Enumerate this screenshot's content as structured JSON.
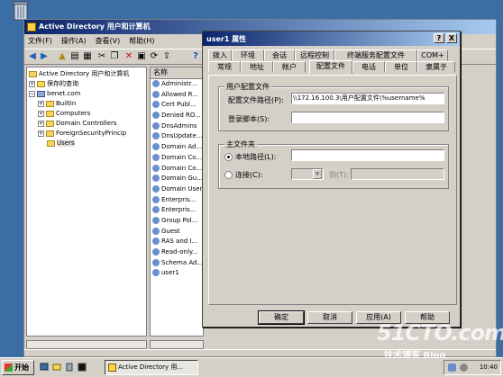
{
  "mmc": {
    "title": "Active Directory 用户和计算机",
    "menu": [
      "文件(F)",
      "操作(A)",
      "查看(V)",
      "帮助(H)"
    ],
    "tree": [
      {
        "label": "Active Directory 用户和计算机",
        "level": 0
      },
      {
        "label": "保存的查询",
        "level": 1
      },
      {
        "label": "benet.com",
        "level": 1
      },
      {
        "label": "Builtin",
        "level": 2
      },
      {
        "label": "Computers",
        "level": 2
      },
      {
        "label": "Domain Controllers",
        "level": 2
      },
      {
        "label": "ForeignSecurityPrincip",
        "level": 2
      },
      {
        "label": "Users",
        "level": 2
      }
    ],
    "list_header": "名称",
    "list": [
      "Administr...",
      "Allowed R...",
      "Cert Publ...",
      "Denied RO...",
      "DnsAdmins",
      "DnsUpdate...",
      "Domain Ad...",
      "Domain Co...",
      "Domain Co...",
      "Domain Gu...",
      "Domain User",
      "Enterpris...",
      "Enterpris...",
      "Group Pol...",
      "Guest",
      "RAS and I...",
      "Read-only...",
      "Schema Ad...",
      "user1"
    ]
  },
  "dialog": {
    "title": "user1 属性",
    "help_btn": "?",
    "close_btn": "X",
    "tabs_row1": [
      "拨入",
      "环境",
      "会话",
      "远程控制",
      "终端服务配置文件",
      "COM+"
    ],
    "tabs_row2": [
      "常规",
      "地址",
      "帐户",
      "配置文件",
      "电话",
      "单位",
      "隶属于"
    ],
    "active_tab": "配置文件",
    "profile_group": "用户配置文件",
    "profile_path_label": "配置文件路径(P):",
    "profile_path_value": "\\\\172.16.100.3\\用户配置文件\\%username%",
    "logon_script_label": "登录脚本(S):",
    "logon_script_value": "",
    "home_group": "主文件夹",
    "local_path_label": "本地路径(L):",
    "local_path_value": "",
    "connect_label": "连接(C):",
    "to_label": "到(T):",
    "ok": "确定",
    "cancel": "取消",
    "apply": "应用(A)",
    "help": "帮助"
  },
  "taskbar": {
    "start": "开始",
    "task": "Active Directory 用...",
    "clock": "10:40"
  },
  "watermark": {
    "main": "51CTO.com",
    "sub": "技术博客 Blog"
  }
}
